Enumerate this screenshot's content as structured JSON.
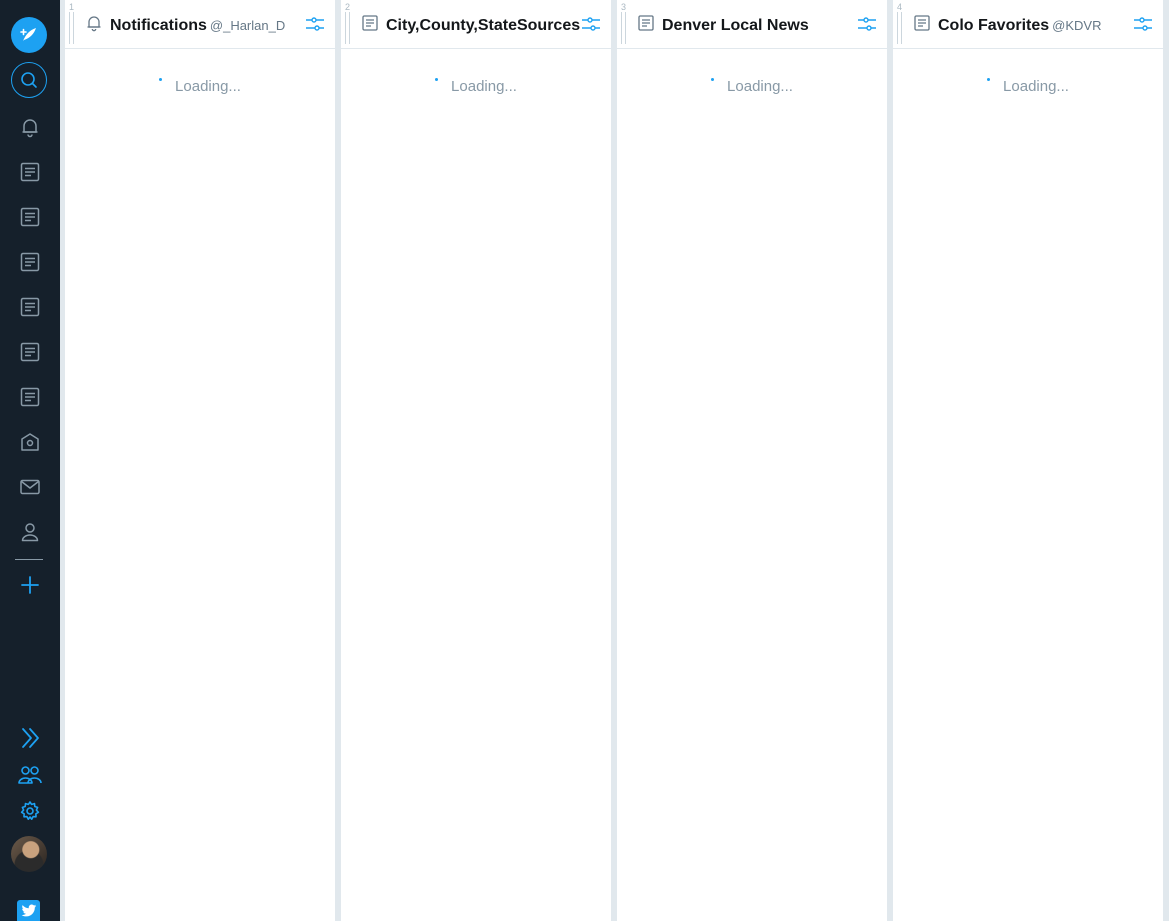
{
  "nav": {
    "items": [
      {
        "name": "compose-icon"
      },
      {
        "name": "search-icon"
      },
      {
        "name": "notifications-icon"
      },
      {
        "name": "list-icon"
      },
      {
        "name": "list-icon"
      },
      {
        "name": "list-icon"
      },
      {
        "name": "list-icon"
      },
      {
        "name": "list-icon"
      },
      {
        "name": "list-icon"
      },
      {
        "name": "home-icon"
      },
      {
        "name": "mail-icon"
      },
      {
        "name": "user-icon"
      },
      {
        "name": "add-column-icon"
      },
      {
        "name": "expand-icon"
      },
      {
        "name": "accounts-icon"
      },
      {
        "name": "settings-icon"
      },
      {
        "name": "avatar"
      },
      {
        "name": "twitter-logo-icon"
      }
    ]
  },
  "columns": [
    {
      "index": "1",
      "icon": "bell-icon",
      "title": "Notifications",
      "handle": "@_Harlan_D",
      "loading": "Loading..."
    },
    {
      "index": "2",
      "icon": "list-icon",
      "title": "City,County,StateSources",
      "handle": "",
      "loading": "Loading..."
    },
    {
      "index": "3",
      "icon": "list-icon",
      "title": "Denver Local News",
      "handle": "",
      "loading": "Loading..."
    },
    {
      "index": "4",
      "icon": "list-icon",
      "title": "Colo Favorites",
      "handle": "@KDVR",
      "loading": "Loading..."
    }
  ],
  "colors": {
    "accent": "#1da1f2",
    "nav_bg": "#15202b",
    "app_bg": "#e1e8ed",
    "icon_gray": "#8899a6"
  }
}
